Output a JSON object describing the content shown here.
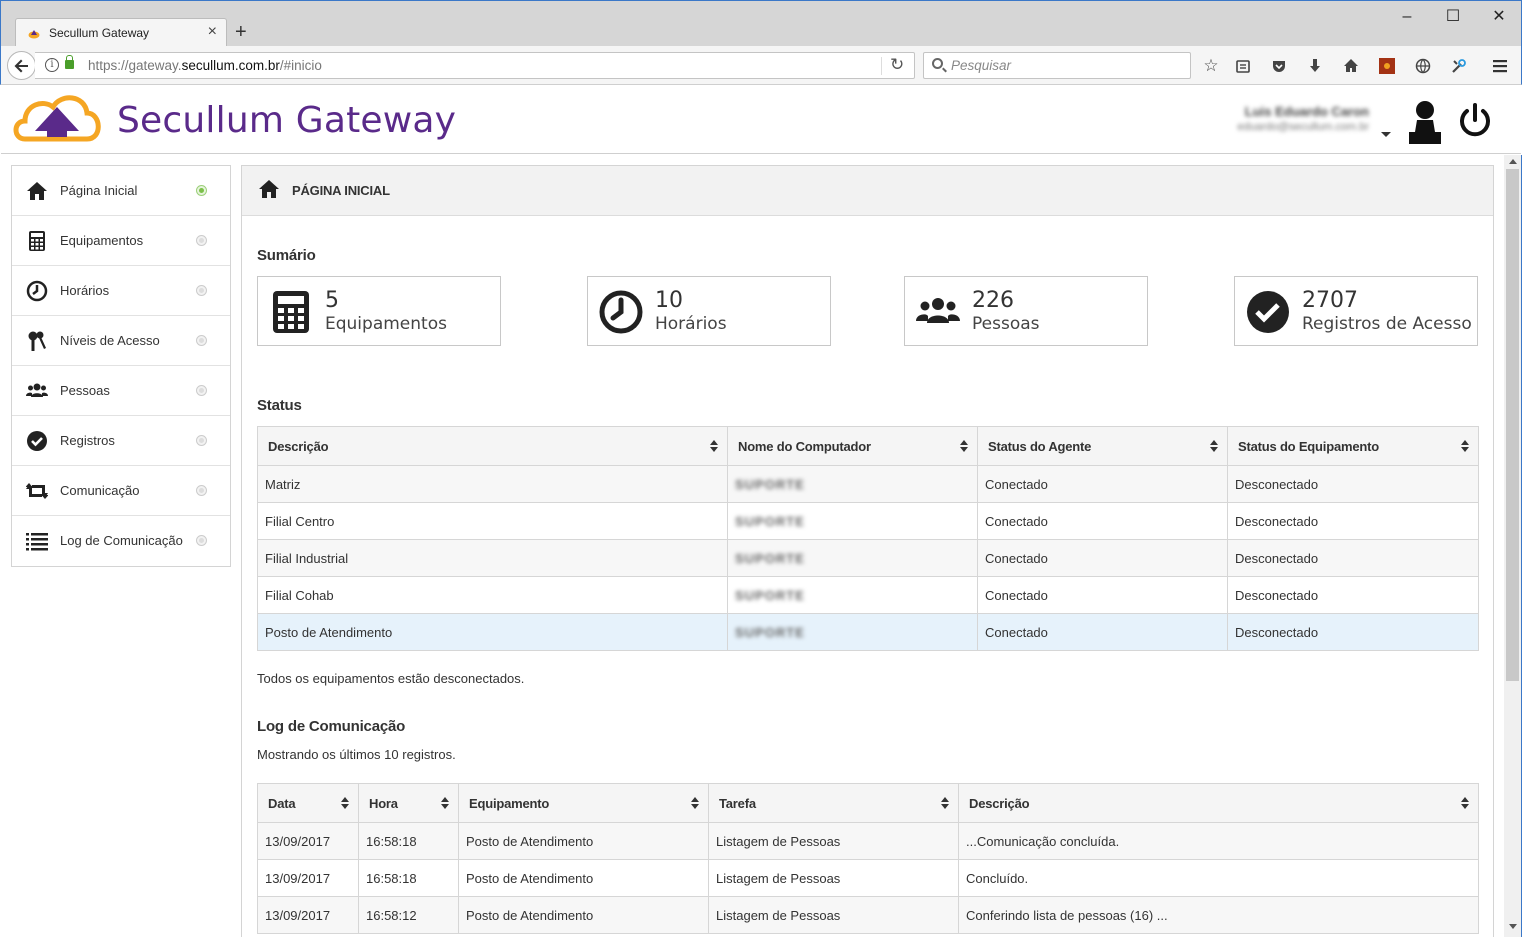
{
  "browser": {
    "tab_title": "Secullum Gateway",
    "url_prefix": "https://gateway.",
    "url_domain": "secullum.com.br",
    "url_suffix": "/#inicio",
    "search_placeholder": "Pesquisar"
  },
  "header": {
    "app_title": "Secullum Gateway",
    "user_name": "Luis Eduardo Caron",
    "user_email": "eduardo@secullum.com.br"
  },
  "sidebar": {
    "items": [
      {
        "label": "Página Inicial",
        "icon": "home-icon",
        "active": true
      },
      {
        "label": "Equipamentos",
        "icon": "calculator-icon",
        "active": false
      },
      {
        "label": "Horários",
        "icon": "clock-icon",
        "active": false
      },
      {
        "label": "Níveis de Acesso",
        "icon": "keys-icon",
        "active": false
      },
      {
        "label": "Pessoas",
        "icon": "people-icon",
        "active": false
      },
      {
        "label": "Registros",
        "icon": "check-circle-icon",
        "active": false
      },
      {
        "label": "Comunicação",
        "icon": "retweet-icon",
        "active": false
      },
      {
        "label": "Log de Comunicação",
        "icon": "list-icon",
        "active": false
      }
    ]
  },
  "main": {
    "page_title": "PÁGINA INICIAL",
    "summary_title": "Sumário",
    "cards": [
      {
        "number": "5",
        "label": "Equipamentos"
      },
      {
        "number": "10",
        "label": "Horários"
      },
      {
        "number": "226",
        "label": "Pessoas"
      },
      {
        "number": "2707",
        "label": "Registros de Acesso"
      }
    ],
    "status_title": "Status",
    "status_table": {
      "headers": [
        "Descrição",
        "Nome do Computador",
        "Status do Agente",
        "Status do Equipamento"
      ],
      "rows": [
        [
          "Matriz",
          "SUPORTE",
          "Conectado",
          "Desconectado"
        ],
        [
          "Filial Centro",
          "SUPORTE",
          "Conectado",
          "Desconectado"
        ],
        [
          "Filial Industrial",
          "SUPORTE",
          "Conectado",
          "Desconectado"
        ],
        [
          "Filial Cohab",
          "SUPORTE",
          "Conectado",
          "Desconectado"
        ],
        [
          "Posto de Atendimento",
          "SUPORTE",
          "Conectado",
          "Desconectado"
        ]
      ]
    },
    "status_note": "Todos os equipamentos estão desconectados.",
    "log_title": "Log de Comunicação",
    "log_subtitle": "Mostrando os últimos 10 registros.",
    "log_table": {
      "headers": [
        "Data",
        "Hora",
        "Equipamento",
        "Tarefa",
        "Descrição"
      ],
      "rows": [
        [
          "13/09/2017",
          "16:58:18",
          "Posto de Atendimento",
          "Listagem de Pessoas",
          "...Comunicação concluída."
        ],
        [
          "13/09/2017",
          "16:58:18",
          "Posto de Atendimento",
          "Listagem de Pessoas",
          "Concluído."
        ],
        [
          "13/09/2017",
          "16:58:12",
          "Posto de Atendimento",
          "Listagem de Pessoas",
          "Conferindo lista de pessoas (16) ..."
        ]
      ]
    }
  },
  "colors": {
    "brand_purple": "#5a2a8a",
    "logo_orange": "#f5a623",
    "connected_green": "#27a22b",
    "disconnected_red": "#d9232a"
  }
}
